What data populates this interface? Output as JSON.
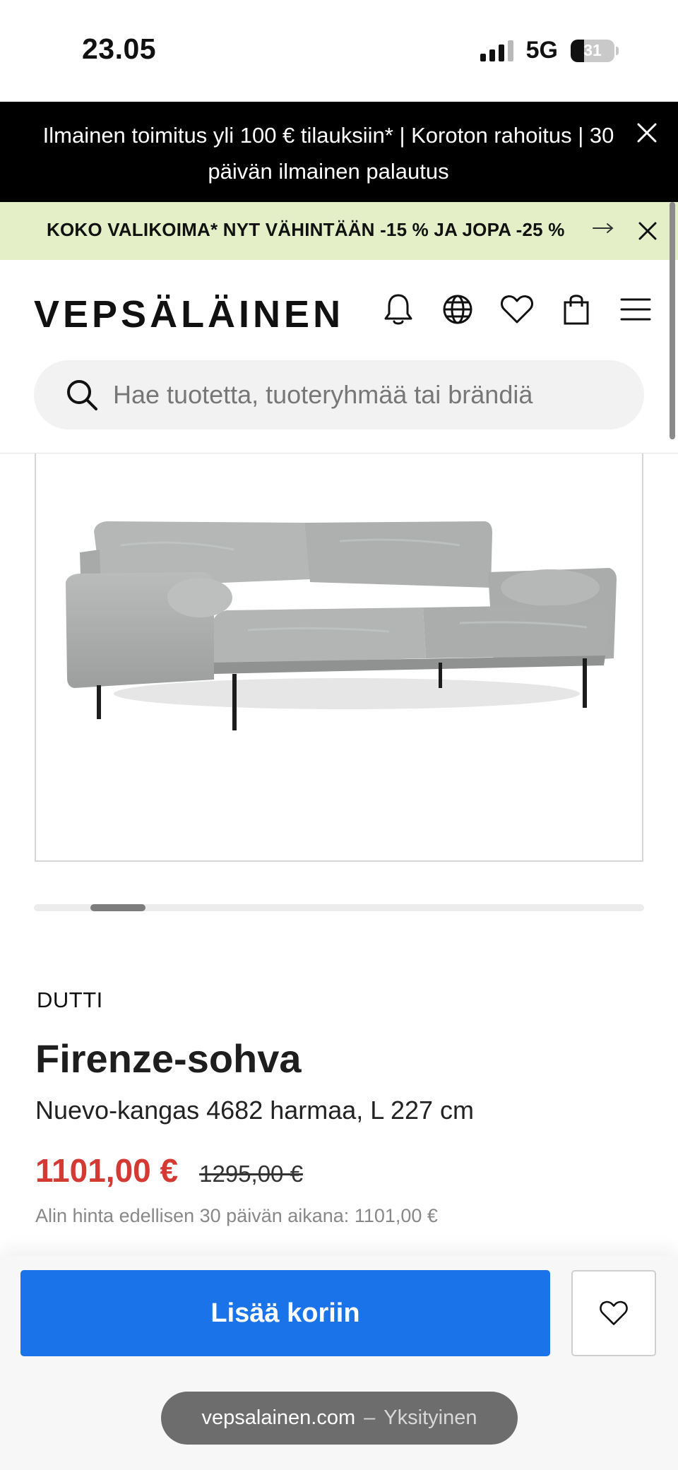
{
  "status_bar": {
    "time": "23.05",
    "network": "5G",
    "battery": "31"
  },
  "promo_banner": {
    "text": "Ilmainen toimitus yli 100 € tilauksiin* | Koroton rahoitus | 30 päivän ilmainen palautus",
    "close_icon": "close-icon"
  },
  "sale_banner": {
    "text": "KOKO VALIKOIMA* NYT VÄHINTÄÄN -15 % JA JOPA -25 %",
    "arrow_icon": "arrow-right-icon",
    "close_icon": "close-icon",
    "background": "#e4efc8"
  },
  "header": {
    "logo": "VEPSÄLÄINEN",
    "icons": [
      "bell-icon",
      "globe-icon",
      "heart-icon",
      "shopping-bag-icon",
      "menu-icon"
    ]
  },
  "search": {
    "placeholder": "Hae tuotetta, tuoteryhmää tai brändiä"
  },
  "carousel": {
    "progress": 0.1
  },
  "product": {
    "brand": "DUTTI",
    "title": "Firenze-sohva",
    "variant": "Nuevo-kangas 4682 harmaa, L 227 cm",
    "price_sale": "1101,00 €",
    "price_original": "1295,00 €",
    "lowest_price_note": "Alin hinta edellisen 30 päivän aikana: 1101,00 €",
    "sale_color": "#d33a34"
  },
  "actions": {
    "add_to_cart_label": "Lisää koriin",
    "accent_color": "#1a73e8",
    "wishlist_icon": "heart-icon"
  },
  "browser": {
    "domain": "vepsalainen.com",
    "separator": "–",
    "mode": "Yksityinen"
  }
}
